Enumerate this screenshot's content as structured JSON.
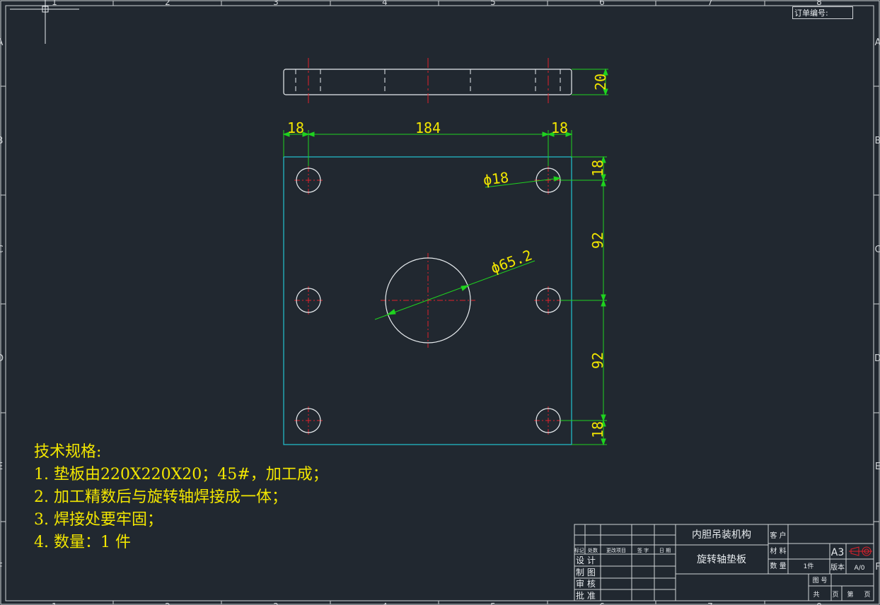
{
  "frame": {
    "column_numbers": [
      "1",
      "2",
      "3",
      "4",
      "5",
      "6",
      "7",
      "8"
    ],
    "row_letters": [
      "A",
      "B",
      "C",
      "D",
      "E",
      "F"
    ],
    "order_number_label": "订单编号:"
  },
  "dimensions": {
    "thickness": "20",
    "left_margin": "18",
    "hole_span": "184",
    "right_margin": "18",
    "small_hole_dia": "ϕ18",
    "center_hole_dia": "ϕ65.2",
    "top_offset": "18",
    "upper_pitch": "92",
    "lower_pitch": "92",
    "bottom_offset": "18"
  },
  "tech_spec": {
    "title": "技术规格:",
    "lines": [
      "1.  垫板由220X220X20；45#，加工成；",
      "2.  加工精数后与旋转轴焊接成一体；",
      "3.  焊接处要牢固；",
      "4.  数量：1 件"
    ]
  },
  "title_block": {
    "assembly_name": "内胆吊装机构",
    "part_name": "旋转轴垫板",
    "customer_label": "客 户",
    "material_label": "材 料",
    "quantity_label": "数 量",
    "quantity_value": "1件",
    "sheet_size": "A3",
    "version_label": "版本",
    "version_value": "A/0",
    "drawing_no_label": "图 号",
    "total_label": "共",
    "page_unit": "页",
    "page_label": "第",
    "rev_headers": [
      "标记",
      "处数",
      "更改项目",
      "签 字",
      "日 期"
    ],
    "roles": [
      "设 计",
      "制 图",
      "审 核",
      "批 准"
    ]
  },
  "colors": {
    "background": "#212830",
    "outline": "#e8ecef",
    "centerline": "#e0202a",
    "dimension": "#1fd21f",
    "dimension_text": "#f2e600",
    "plate_top_view": "#22c3d0"
  }
}
